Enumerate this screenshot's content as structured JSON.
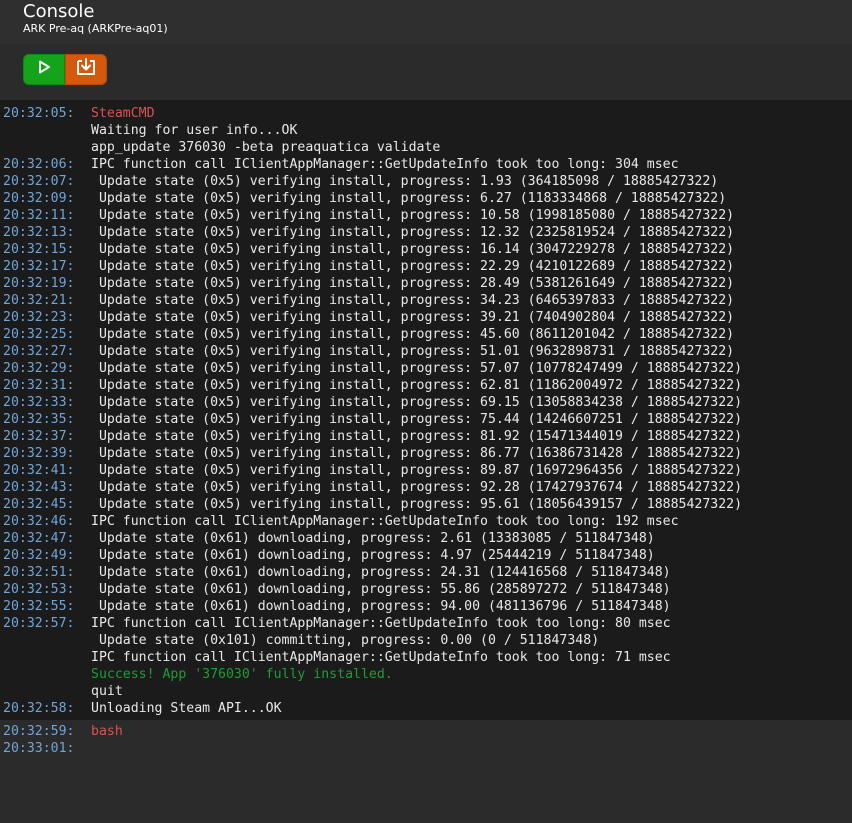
{
  "header": {
    "title": "Console",
    "subtitle": "ARK Pre-aq (ARKPre-aq01)"
  },
  "colors": {
    "start": "#14a31a",
    "update": "#d4590c",
    "timestamp": "#6fa5d8",
    "error_label": "#d9534f",
    "success": "#1e9e35"
  },
  "toolbar": {
    "start_icon": "play-icon",
    "update_icon": "download-icon"
  },
  "log": [
    {
      "ts": "20:32:05:",
      "msg": "SteamCMD",
      "style": "red"
    },
    {
      "ts": "",
      "msg": "Waiting for user info...OK",
      "style": ""
    },
    {
      "ts": "",
      "msg": "app_update 376030 -beta preaquatica validate",
      "style": ""
    },
    {
      "ts": "20:32:06:",
      "msg": "IPC function call IClientAppManager::GetUpdateInfo took too long: 304 msec",
      "style": ""
    },
    {
      "ts": "20:32:07:",
      "msg": " Update state (0x5) verifying install, progress: 1.93 (364185098 / 18885427322)",
      "style": ""
    },
    {
      "ts": "20:32:09:",
      "msg": " Update state (0x5) verifying install, progress: 6.27 (1183334868 / 18885427322)",
      "style": ""
    },
    {
      "ts": "20:32:11:",
      "msg": " Update state (0x5) verifying install, progress: 10.58 (1998185080 / 18885427322)",
      "style": ""
    },
    {
      "ts": "20:32:13:",
      "msg": " Update state (0x5) verifying install, progress: 12.32 (2325819524 / 18885427322)",
      "style": ""
    },
    {
      "ts": "20:32:15:",
      "msg": " Update state (0x5) verifying install, progress: 16.14 (3047229278 / 18885427322)",
      "style": ""
    },
    {
      "ts": "20:32:17:",
      "msg": " Update state (0x5) verifying install, progress: 22.29 (4210122689 / 18885427322)",
      "style": ""
    },
    {
      "ts": "20:32:19:",
      "msg": " Update state (0x5) verifying install, progress: 28.49 (5381261649 / 18885427322)",
      "style": ""
    },
    {
      "ts": "20:32:21:",
      "msg": " Update state (0x5) verifying install, progress: 34.23 (6465397833 / 18885427322)",
      "style": ""
    },
    {
      "ts": "20:32:23:",
      "msg": " Update state (0x5) verifying install, progress: 39.21 (7404902804 / 18885427322)",
      "style": ""
    },
    {
      "ts": "20:32:25:",
      "msg": " Update state (0x5) verifying install, progress: 45.60 (8611201042 / 18885427322)",
      "style": ""
    },
    {
      "ts": "20:32:27:",
      "msg": " Update state (0x5) verifying install, progress: 51.01 (9632898731 / 18885427322)",
      "style": ""
    },
    {
      "ts": "20:32:29:",
      "msg": " Update state (0x5) verifying install, progress: 57.07 (10778247499 / 18885427322)",
      "style": ""
    },
    {
      "ts": "20:32:31:",
      "msg": " Update state (0x5) verifying install, progress: 62.81 (11862004972 / 18885427322)",
      "style": ""
    },
    {
      "ts": "20:32:33:",
      "msg": " Update state (0x5) verifying install, progress: 69.15 (13058834238 / 18885427322)",
      "style": ""
    },
    {
      "ts": "20:32:35:",
      "msg": " Update state (0x5) verifying install, progress: 75.44 (14246607251 / 18885427322)",
      "style": ""
    },
    {
      "ts": "20:32:37:",
      "msg": " Update state (0x5) verifying install, progress: 81.92 (15471344019 / 18885427322)",
      "style": ""
    },
    {
      "ts": "20:32:39:",
      "msg": " Update state (0x5) verifying install, progress: 86.77 (16386731428 / 18885427322)",
      "style": ""
    },
    {
      "ts": "20:32:41:",
      "msg": " Update state (0x5) verifying install, progress: 89.87 (16972964356 / 18885427322)",
      "style": ""
    },
    {
      "ts": "20:32:43:",
      "msg": " Update state (0x5) verifying install, progress: 92.28 (17427937674 / 18885427322)",
      "style": ""
    },
    {
      "ts": "20:32:45:",
      "msg": " Update state (0x5) verifying install, progress: 95.61 (18056439157 / 18885427322)",
      "style": ""
    },
    {
      "ts": "20:32:46:",
      "msg": "IPC function call IClientAppManager::GetUpdateInfo took too long: 192 msec",
      "style": ""
    },
    {
      "ts": "20:32:47:",
      "msg": " Update state (0x61) downloading, progress: 2.61 (13383085 / 511847348)",
      "style": ""
    },
    {
      "ts": "20:32:49:",
      "msg": " Update state (0x61) downloading, progress: 4.97 (25444219 / 511847348)",
      "style": ""
    },
    {
      "ts": "20:32:51:",
      "msg": " Update state (0x61) downloading, progress: 24.31 (124416568 / 511847348)",
      "style": ""
    },
    {
      "ts": "20:32:53:",
      "msg": " Update state (0x61) downloading, progress: 55.86 (285897272 / 511847348)",
      "style": ""
    },
    {
      "ts": "20:32:55:",
      "msg": " Update state (0x61) downloading, progress: 94.00 (481136796 / 511847348)",
      "style": ""
    },
    {
      "ts": "20:32:57:",
      "msg": "IPC function call IClientAppManager::GetUpdateInfo took too long: 80 msec",
      "style": ""
    },
    {
      "ts": "",
      "msg": " Update state (0x101) committing, progress: 0.00 (0 / 511847348)",
      "style": ""
    },
    {
      "ts": "",
      "msg": "IPC function call IClientAppManager::GetUpdateInfo took too long: 71 msec",
      "style": ""
    },
    {
      "ts": "",
      "msg": "Success! App '376030' fully installed.",
      "style": "green"
    },
    {
      "ts": "",
      "msg": "quit",
      "style": ""
    },
    {
      "ts": "20:32:58:",
      "msg": "Unloading Steam API...OK",
      "style": ""
    }
  ],
  "log2": [
    {
      "ts": "20:32:59:",
      "msg": "bash",
      "style": "red"
    },
    {
      "ts": "20:33:01:",
      "msg": "",
      "style": ""
    }
  ]
}
